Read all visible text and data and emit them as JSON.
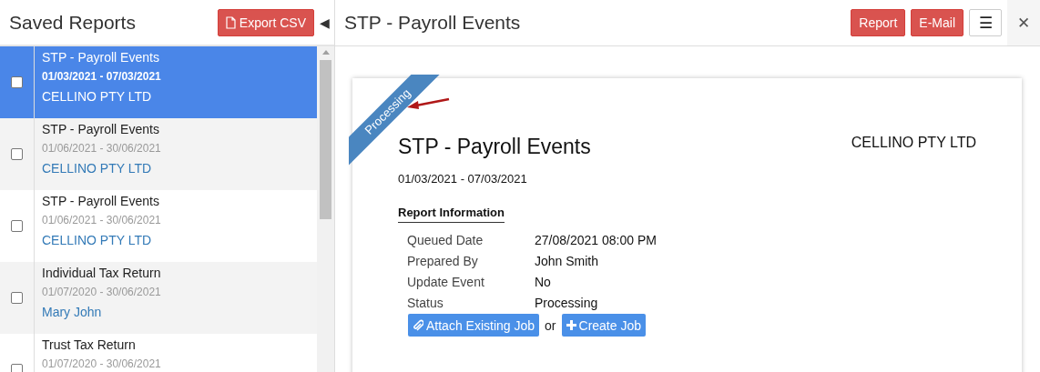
{
  "sidebar": {
    "title": "Saved Reports",
    "export_button": "Export CSV",
    "collapse_icon": "◀",
    "items": [
      {
        "title": "STP - Payroll Events",
        "dates": "01/03/2021 - 07/03/2021",
        "entity": "CELLINO PTY LTD",
        "selected": true,
        "checked": false
      },
      {
        "title": "STP - Payroll Events",
        "dates": "01/06/2021 - 30/06/2021",
        "entity": "CELLINO PTY LTD",
        "selected": false,
        "checked": false
      },
      {
        "title": "STP - Payroll Events",
        "dates": "01/06/2021 - 30/06/2021",
        "entity": "CELLINO PTY LTD",
        "selected": false,
        "checked": false
      },
      {
        "title": "Individual Tax Return",
        "dates": "01/07/2020 - 30/06/2021",
        "entity": "Mary John",
        "selected": false,
        "checked": false
      },
      {
        "title": "Trust Tax Return",
        "dates": "01/07/2020 - 30/06/2021",
        "selected": false,
        "checked": false
      }
    ]
  },
  "header": {
    "title": "STP - Payroll Events",
    "buttons": [
      "Report",
      "E-Mail"
    ],
    "menu_icon": "☰",
    "close_icon": "✕"
  },
  "report": {
    "ribbon": "Processing",
    "title": "STP - Payroll Events",
    "entity": "CELLINO PTY LTD",
    "dates": "01/03/2021 - 07/03/2021",
    "section": "Report Information",
    "fields": [
      {
        "label": "Queued Date",
        "value": "27/08/2021 08:00 PM"
      },
      {
        "label": "Prepared By",
        "value": "John Smith"
      },
      {
        "label": "Update Event",
        "value": "No"
      },
      {
        "label": "Status",
        "value": "Processing"
      }
    ],
    "attach_button": "Attach Existing Job",
    "or": "or",
    "create_button": "Create Job"
  }
}
